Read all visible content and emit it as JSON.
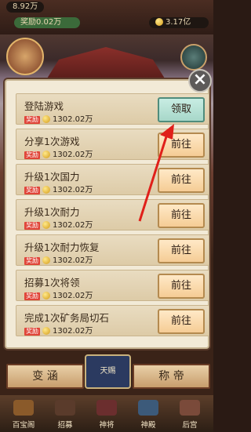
{
  "top": {
    "left_value": "8.92万",
    "gold": "3.17亿",
    "bar_text": "奖励0.02万"
  },
  "close_label": "×",
  "reward_label": "奖励",
  "tasks": [
    {
      "title": "登陆游戏",
      "reward": "1302.02万",
      "button": "领取",
      "state": "claim"
    },
    {
      "title": "分享1次游戏",
      "reward": "1302.02万",
      "button": "前往",
      "state": "go"
    },
    {
      "title": "升级1次国力",
      "reward": "1302.02万",
      "button": "前往",
      "state": "go"
    },
    {
      "title": "升级1次耐力",
      "reward": "1302.02万",
      "button": "前往",
      "state": "go"
    },
    {
      "title": "升级1次耐力恢复",
      "reward": "1302.02万",
      "button": "前往",
      "state": "go"
    },
    {
      "title": "招募1次将领",
      "reward": "1302.02万",
      "button": "前往",
      "state": "go"
    },
    {
      "title": "完成1次矿务局切石",
      "reward": "1302.02万",
      "button": "前往",
      "state": "go"
    }
  ],
  "actions": {
    "left": "变 涵",
    "right": "称 帝",
    "center": "天赐"
  },
  "nav": [
    {
      "label": "百宝阁",
      "icon": "treasure-icon"
    },
    {
      "label": "招募",
      "icon": "recruit-icon"
    },
    {
      "label": "神将",
      "icon": "general-icon"
    },
    {
      "label": "神殿",
      "icon": "temple-icon"
    },
    {
      "label": "后宫",
      "icon": "palace-icon"
    }
  ],
  "colors": {
    "claim": "#a7d7c9",
    "go": "#f5cc95",
    "reward_tag": "#e04438"
  }
}
